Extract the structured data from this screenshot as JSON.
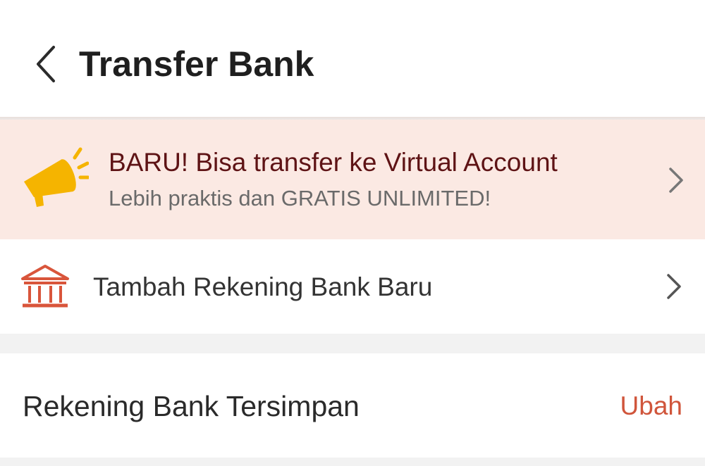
{
  "header": {
    "title": "Transfer Bank",
    "back_icon": "chevron-left-icon"
  },
  "promo": {
    "icon": "megaphone-icon",
    "title": "BARU! Bisa transfer ke Virtual Account",
    "subtitle": "Lebih praktis dan GRATIS UNLIMITED!",
    "background_color": "#fbe9e3",
    "title_color": "#5e1315",
    "icon_color": "#f5b400"
  },
  "add_bank": {
    "icon": "bank-icon",
    "label": "Tambah Rekening Bank Baru",
    "icon_color": "#d9553b"
  },
  "saved_accounts": {
    "title": "Rekening Bank Tersimpan",
    "edit_label": "Ubah",
    "edit_color": "#d0553b"
  }
}
